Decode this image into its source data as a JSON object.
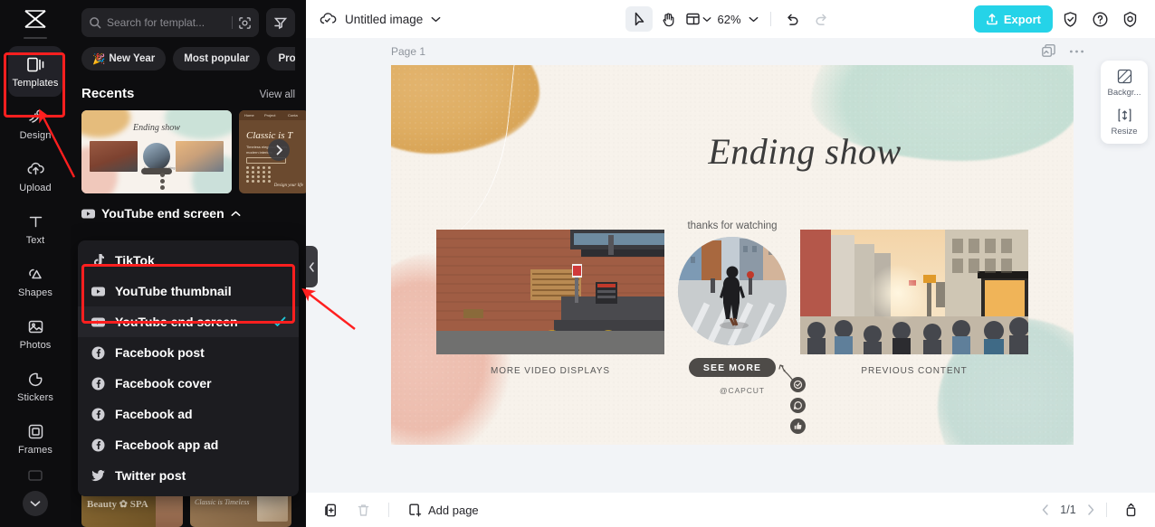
{
  "rail": {
    "logo_icon": "capcut-logo-icon",
    "items": [
      {
        "label": "Templates",
        "icon": "templates-icon",
        "active": true
      },
      {
        "label": "Design",
        "icon": "design-icon",
        "active": false
      },
      {
        "label": "Upload",
        "icon": "upload-icon",
        "active": false
      },
      {
        "label": "Text",
        "icon": "text-icon",
        "active": false
      },
      {
        "label": "Shapes",
        "icon": "shapes-icon",
        "active": false
      },
      {
        "label": "Photos",
        "icon": "photos-icon",
        "active": false
      },
      {
        "label": "Stickers",
        "icon": "stickers-icon",
        "active": false
      },
      {
        "label": "Frames",
        "icon": "frames-icon",
        "active": false
      }
    ],
    "more_icon": "chevron-down-icon"
  },
  "panel": {
    "search": {
      "placeholder": "Search for templat...",
      "search_icon": "search-icon",
      "image_search_icon": "image-search-icon",
      "filter_icon": "filter-icon"
    },
    "chips": [
      {
        "label": "New Year",
        "emoji": "🎉"
      },
      {
        "label": "Most popular",
        "emoji": ""
      },
      {
        "label": "Prod",
        "emoji": ""
      }
    ],
    "section": {
      "title": "Recents",
      "view_all": "View all"
    },
    "recents": [
      {
        "name": "ending-show-template",
        "title": "Ending show"
      },
      {
        "name": "classic-is-template",
        "title": "Classic is T"
      }
    ],
    "carousel_next_icon": "chevron-right-icon",
    "dropdown": {
      "selected_label": "YouTube end screen",
      "selected_icon": "youtube-icon",
      "caret_icon": "chevron-up-icon",
      "items": [
        {
          "label": "TikTok",
          "icon": "tiktok-icon",
          "checked": false,
          "highlighted": false
        },
        {
          "label": "YouTube thumbnail",
          "icon": "youtube-icon",
          "checked": false,
          "highlighted": true
        },
        {
          "label": "YouTube end screen",
          "icon": "youtube-icon",
          "checked": true,
          "highlighted": true
        },
        {
          "label": "Facebook post",
          "icon": "facebook-icon",
          "checked": false,
          "highlighted": false
        },
        {
          "label": "Facebook cover",
          "icon": "facebook-icon",
          "checked": false,
          "highlighted": false
        },
        {
          "label": "Facebook ad",
          "icon": "facebook-icon",
          "checked": false,
          "highlighted": false
        },
        {
          "label": "Facebook app ad",
          "icon": "facebook-icon",
          "checked": false,
          "highlighted": false
        },
        {
          "label": "Twitter post",
          "icon": "twitter-icon",
          "checked": false,
          "highlighted": false
        }
      ]
    },
    "collapse_handle_icon": "chevron-left-icon",
    "peek_templates": [
      {
        "name": "template-wedding"
      },
      {
        "name": "template-interior"
      },
      {
        "name": "template-beauty-spa",
        "title": "Beauty ✿ SPA"
      },
      {
        "name": "template-classic-timeless",
        "title": "Classic is Timeless"
      }
    ]
  },
  "topbar": {
    "cloud_icon": "cloud-saved-icon",
    "doc_title": "Untitled image",
    "doc_caret_icon": "chevron-down-icon",
    "tools": [
      {
        "name": "select-tool",
        "icon": "cursor-icon",
        "active": true
      },
      {
        "name": "hand-tool",
        "icon": "hand-icon",
        "active": false
      },
      {
        "name": "layout-tool",
        "icon": "layout-icon",
        "active": false
      }
    ],
    "zoom_level": "62%",
    "zoom_caret_icon": "chevron-down-icon",
    "undo_icon": "undo-icon",
    "redo_icon": "redo-icon",
    "export_label": "Export",
    "export_icon": "export-upload-icon",
    "export_color": "#25d3e8",
    "right_icons": [
      {
        "name": "shield-icon"
      },
      {
        "name": "help-icon"
      },
      {
        "name": "settings-icon"
      }
    ]
  },
  "canvas": {
    "page_label": "Page 1",
    "page_tools": [
      {
        "name": "duplicate-page-icon"
      },
      {
        "name": "more-options-icon"
      }
    ],
    "design": {
      "title": "Ending show",
      "thanks_text": "thanks for watching",
      "left_caption": "MORE VIDEO DISPLAYS",
      "right_caption": "PREVIOUS CONTENT",
      "cta_label": "SEE MORE",
      "handle": "@CAPCUT",
      "socials": [
        {
          "name": "checkmark-badge-icon"
        },
        {
          "name": "chat-bubble-icon"
        },
        {
          "name": "thumbs-up-icon"
        }
      ],
      "palette": {
        "paper": "#f7f2eb",
        "tan": "#dfae63",
        "mint": "#c5dfd4",
        "pink": "#edbdae",
        "cta": "#4e4b48"
      }
    }
  },
  "side_tools": [
    {
      "label": "Backgr...",
      "icon": "background-icon"
    },
    {
      "label": "Resize",
      "icon": "resize-icon"
    }
  ],
  "bottombar": {
    "duplicate_icon": "duplicate-icon",
    "delete_icon": "trash-icon",
    "add_page_label": "Add page",
    "add_page_icon": "add-page-icon",
    "prev_icon": "chevron-left-icon",
    "page_indicator": "1/1",
    "next_icon": "chevron-right-icon",
    "expand_icon": "expand-panel-icon"
  },
  "annotations": {
    "highlight_color": "#ff1f1f",
    "arrows": [
      {
        "name": "arrow-to-templates"
      },
      {
        "name": "arrow-to-dropdown-selection"
      }
    ]
  }
}
